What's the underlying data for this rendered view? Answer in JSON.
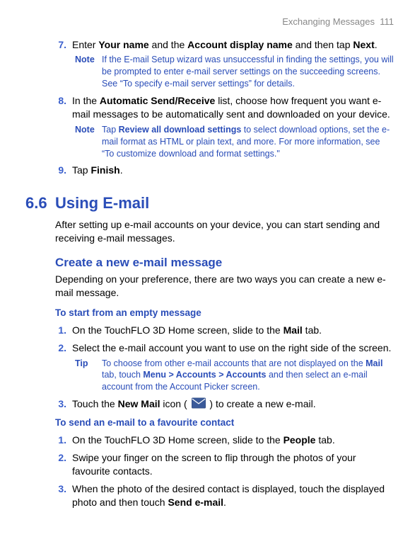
{
  "header": {
    "section": "Exchanging Messages",
    "page": "111"
  },
  "steps_top": [
    {
      "num": "7.",
      "text_a": "Enter ",
      "b1": "Your name",
      "text_b": " and the ",
      "b2": "Account display name",
      "text_c": " and then tap ",
      "b3": "Next",
      "text_d": "."
    },
    {
      "num": "8.",
      "text_a": "In the ",
      "b1": "Automatic Send/Receive",
      "text_b": " list, choose how frequent you want e-mail messages to be automatically sent and downloaded on your device."
    },
    {
      "num": "9.",
      "text_a": "Tap ",
      "b1": "Finish",
      "text_b": "."
    }
  ],
  "notes_top": [
    {
      "label": "Note",
      "text": "If the E-mail Setup wizard was unsuccessful in finding the settings, you will be prompted to enter e-mail server settings on the succeeding screens. See “To specify e-mail server settings” for details."
    },
    {
      "label": "Note",
      "text_a": "Tap ",
      "b1": "Review all download settings",
      "text_b": " to select download options, set the e-mail format as HTML or plain text, and more. For more information, see “To customize download and format settings.\""
    }
  ],
  "section": {
    "num": "6.6",
    "title": "Using E-mail"
  },
  "section_intro": "After setting up e-mail accounts on your device, you can start sending and receiving e-mail messages.",
  "sub1": {
    "heading": "Create a new e-mail message",
    "desc": "Depending on your preference, there are two ways you can create a new e-mail message."
  },
  "ss1": {
    "heading": "To start from an empty message",
    "steps": {
      "s1": {
        "num": "1.",
        "a": "On the TouchFLO 3D Home screen, slide to the ",
        "b1": "Mail",
        "c": " tab."
      },
      "s2": {
        "num": "2.",
        "a": "Select the e-mail account you want to use on the right side of the screen."
      },
      "s3": {
        "num": "3.",
        "a": "Touch the ",
        "b1": "New Mail",
        "b": " icon ( ",
        "c": " ) to create a new e-mail."
      }
    },
    "tip": {
      "label": "Tip",
      "a": "To choose from other e-mail accounts that are not displayed on the ",
      "b1": "Mail",
      "b": " tab, touch ",
      "b2": "Menu > Accounts > Accounts",
      "c": " and then select an e-mail account from the Account Picker screen."
    }
  },
  "ss2": {
    "heading": "To send an e-mail to a favourite contact",
    "steps": {
      "s1": {
        "num": "1.",
        "a": "On the TouchFLO 3D Home screen, slide to the ",
        "b1": "People",
        "c": " tab."
      },
      "s2": {
        "num": "2.",
        "a": "Swipe your finger on the screen to flip through the photos of your favourite contacts."
      },
      "s3": {
        "num": "3.",
        "a": "When the photo of the desired contact is displayed, touch the displayed photo and then touch ",
        "b1": "Send e-mail",
        "c": "."
      }
    }
  }
}
